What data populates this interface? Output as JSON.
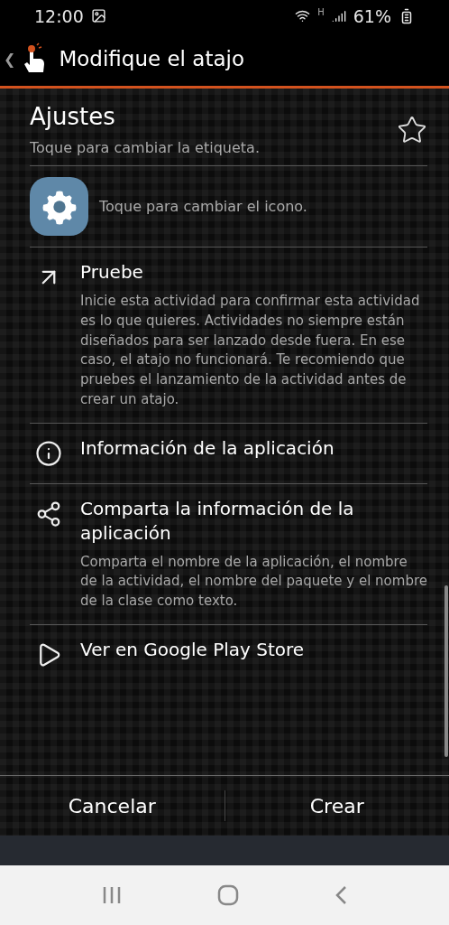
{
  "status_bar": {
    "time": "12:00",
    "network": "H",
    "battery": "61%"
  },
  "header": {
    "back": "❮",
    "title": "Modifique el atajo"
  },
  "label": {
    "title": "Ajustes",
    "hint": "Toque para cambiar la etiqueta."
  },
  "icon_row": {
    "hint": "Toque para cambiar el icono."
  },
  "actions": [
    {
      "title": "Pruebe",
      "description": "Inicie esta actividad para confirmar esta actividad es lo que quieres. Actividades no siempre están diseñados para ser lanzado desde fuera. En ese caso, el atajo no funcionará. Te recomiendo que pruebes el lanzamiento de la actividad antes de crear un atajo."
    },
    {
      "title": "Información de la aplicación"
    },
    {
      "title": "Comparta la información de la aplicación",
      "description": "Comparta el nombre de la aplicación, el nombre de la actividad, el nombre del paquete y el nombre de la clase como texto."
    },
    {
      "title": "Ver en Google Play Store"
    }
  ],
  "buttons": [
    "Cancelar",
    "Crear"
  ]
}
